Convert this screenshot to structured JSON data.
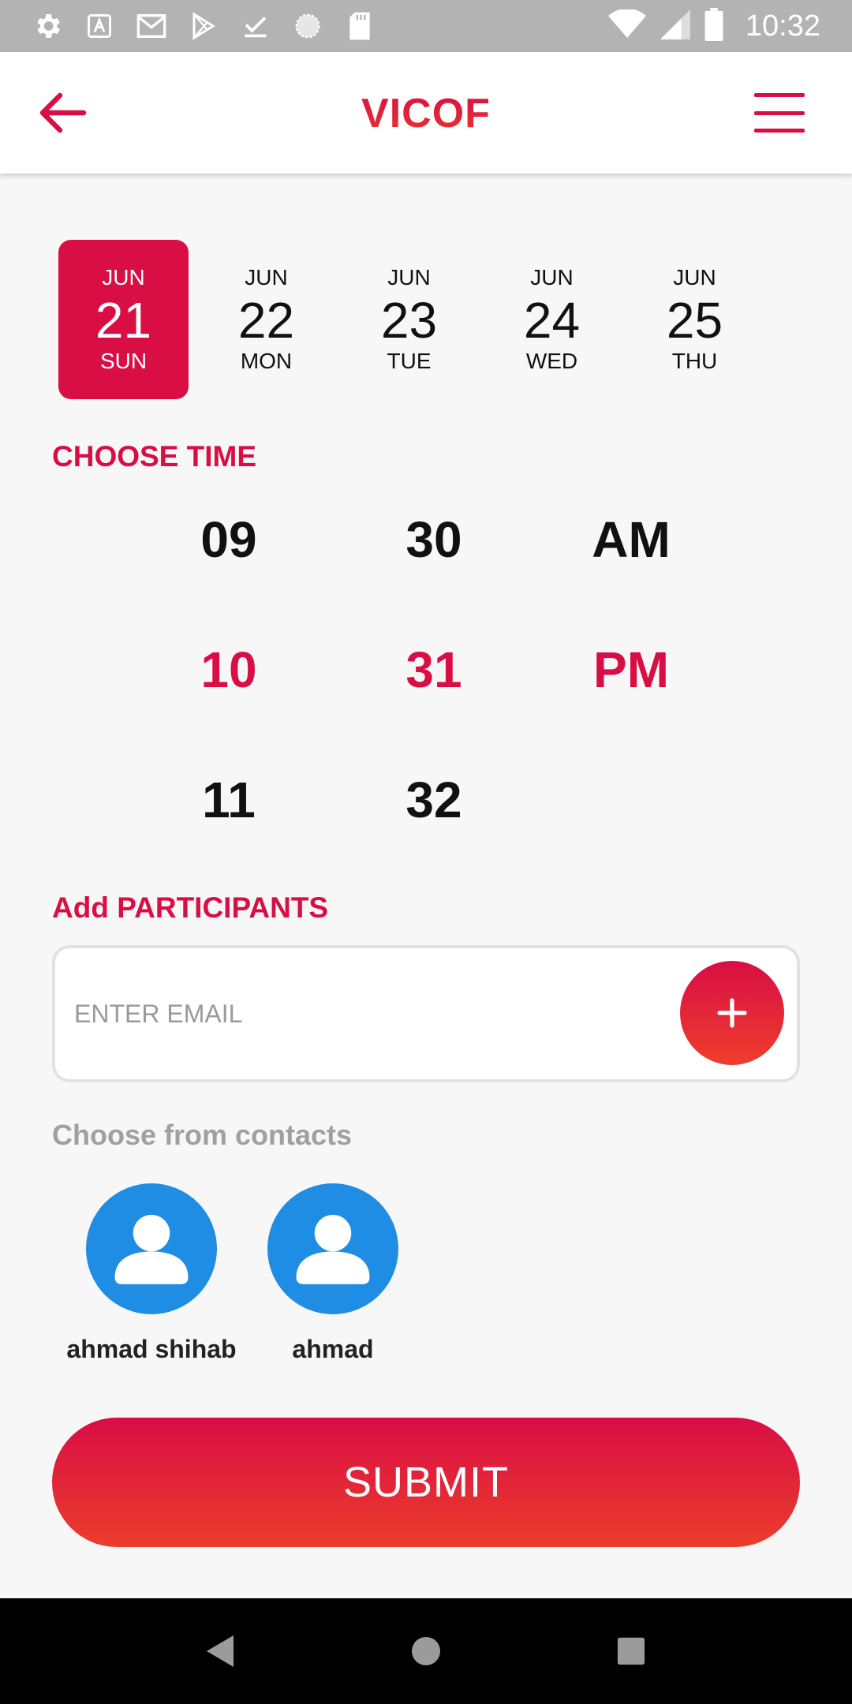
{
  "status_bar": {
    "time": "10:32",
    "icons_left": [
      "settings-icon",
      "a-keyboard-icon",
      "gmail-icon",
      "play-store-icon",
      "download-done-icon",
      "sync-circle-icon",
      "sd-card-icon"
    ],
    "icons_right": [
      "wifi-icon",
      "cell-signal-icon",
      "battery-icon"
    ]
  },
  "app_bar": {
    "title": "VICOF",
    "back_icon": "arrow-back-icon",
    "menu_icon": "hamburger-menu-icon",
    "accent_color": "#d80e45"
  },
  "dates": [
    {
      "month": "JUN",
      "day": "21",
      "weekday": "SUN",
      "selected": true
    },
    {
      "month": "JUN",
      "day": "22",
      "weekday": "MON",
      "selected": false
    },
    {
      "month": "JUN",
      "day": "23",
      "weekday": "TUE",
      "selected": false
    },
    {
      "month": "JUN",
      "day": "24",
      "weekday": "WED",
      "selected": false
    },
    {
      "month": "JUN",
      "day": "25",
      "weekday": "THU",
      "selected": false
    }
  ],
  "time_picker": {
    "label": "CHOOSE TIME",
    "hours": [
      "09",
      "10",
      "11"
    ],
    "minutes": [
      "30",
      "31",
      "32"
    ],
    "periods": [
      "AM",
      "PM"
    ],
    "selected_hour": "10",
    "selected_minute": "31",
    "selected_period": "PM"
  },
  "participants": {
    "label": "Add PARTICIPANTS",
    "email_placeholder": "ENTER EMAIL",
    "email_value": "",
    "add_icon": "plus-icon"
  },
  "contacts": {
    "label": "Choose from contacts",
    "items": [
      {
        "name": "ahmad shihab",
        "avatar_icon": "person-avatar-icon"
      },
      {
        "name": "ahmad",
        "avatar_icon": "person-avatar-icon"
      }
    ]
  },
  "submit": {
    "label": "SUBMIT"
  },
  "nav_bar": {
    "back_icon": "nav-back-icon",
    "home_icon": "nav-home-icon",
    "recents_icon": "nav-recents-icon"
  }
}
